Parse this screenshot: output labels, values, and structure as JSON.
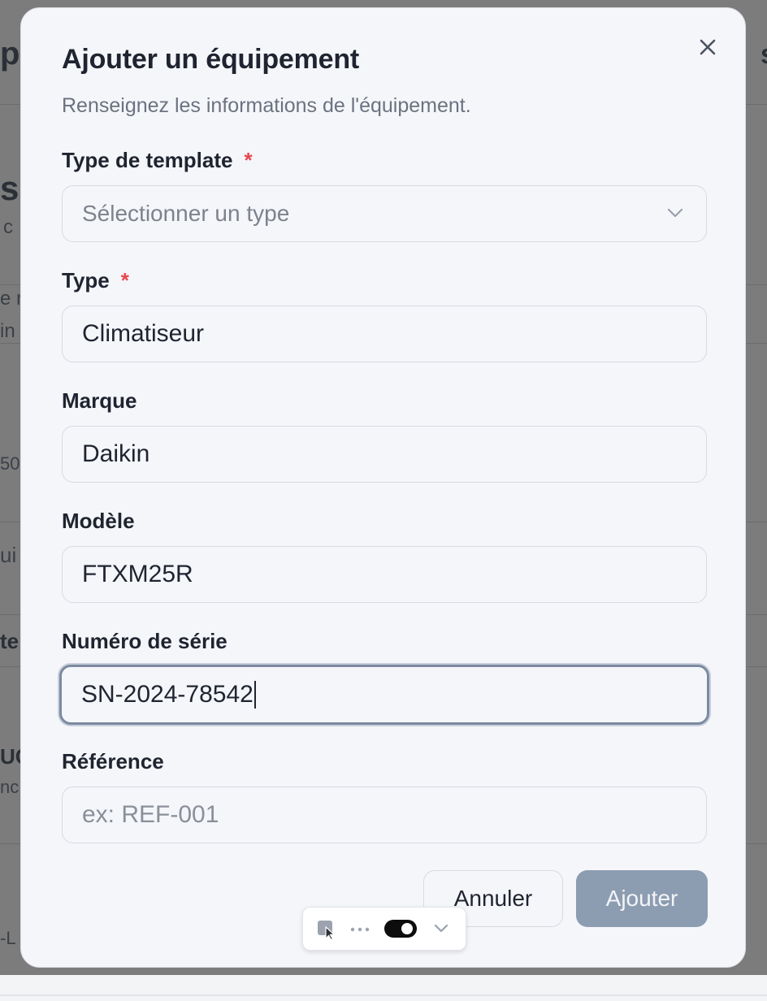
{
  "background": {
    "fragments": [
      "p",
      "s",
      "s",
      "c",
      "e r",
      "in",
      "50",
      "ui",
      "te",
      "UC",
      "nc",
      "-L"
    ]
  },
  "dialog": {
    "title": "Ajouter un équipement",
    "subtitle": "Renseignez les informations de l'équipement.",
    "close_icon": "close-icon",
    "fields": {
      "template_type": {
        "label": "Type de template",
        "required_mark": "*",
        "placeholder": "Sélectionner un type",
        "value": ""
      },
      "type": {
        "label": "Type",
        "required_mark": "*",
        "value": "Climatiseur"
      },
      "brand": {
        "label": "Marque",
        "value": "Daikin"
      },
      "model": {
        "label": "Modèle",
        "value": "FTXM25R"
      },
      "serial_number": {
        "label": "Numéro de série",
        "value": "SN-2024-78542"
      },
      "reference": {
        "label": "Référence",
        "placeholder": "ex: REF-001",
        "value": ""
      }
    },
    "buttons": {
      "cancel": "Annuler",
      "submit": "Ajouter"
    }
  },
  "floating_toolbar": {
    "icons": [
      "cursor-select-icon",
      "more-icon",
      "toggle-switch",
      "chevron-down-icon"
    ],
    "toggle_on": true
  },
  "colors": {
    "required": "#e5484d",
    "submit_bg": "#8c9db1",
    "focus_border": "#7b8aa0",
    "overlay": "#7b7b7b"
  }
}
